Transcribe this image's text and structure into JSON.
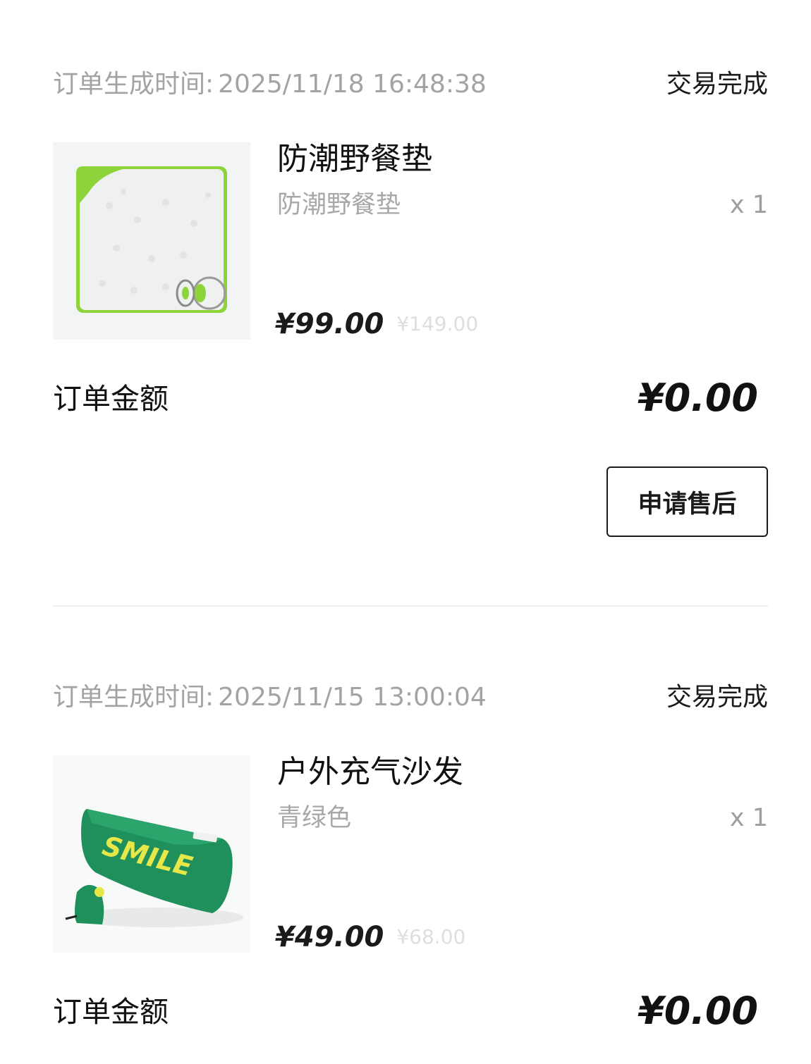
{
  "orders": [
    {
      "time_label": "订单生成时间:",
      "time_value": "2025/11/18 16:48:38",
      "status": "交易完成",
      "product": {
        "name": "防潮野餐垫",
        "spec": "防潮野餐垫",
        "qty": "x 1",
        "price": "¥99.00",
        "original_price": "¥149.00",
        "image_icon": "picnic-mat-image"
      },
      "total_label": "订单金额",
      "total_value": "¥0.00",
      "aftersale_label": "申请售后"
    },
    {
      "time_label": "订单生成时间:",
      "time_value": "2025/11/15 13:00:04",
      "status": "交易完成",
      "product": {
        "name": "户外充气沙发",
        "spec": "青绿色",
        "qty": "x 1",
        "price": "¥49.00",
        "original_price": "¥68.00",
        "image_icon": "inflatable-sofa-image",
        "image_text": "SMILE"
      },
      "total_label": "订单金额",
      "total_value": "¥0.00"
    }
  ],
  "colors": {
    "accent_green": "#8cd43a",
    "sofa_green": "#1f8f5c",
    "sofa_text_yellow": "#e6e84a"
  }
}
